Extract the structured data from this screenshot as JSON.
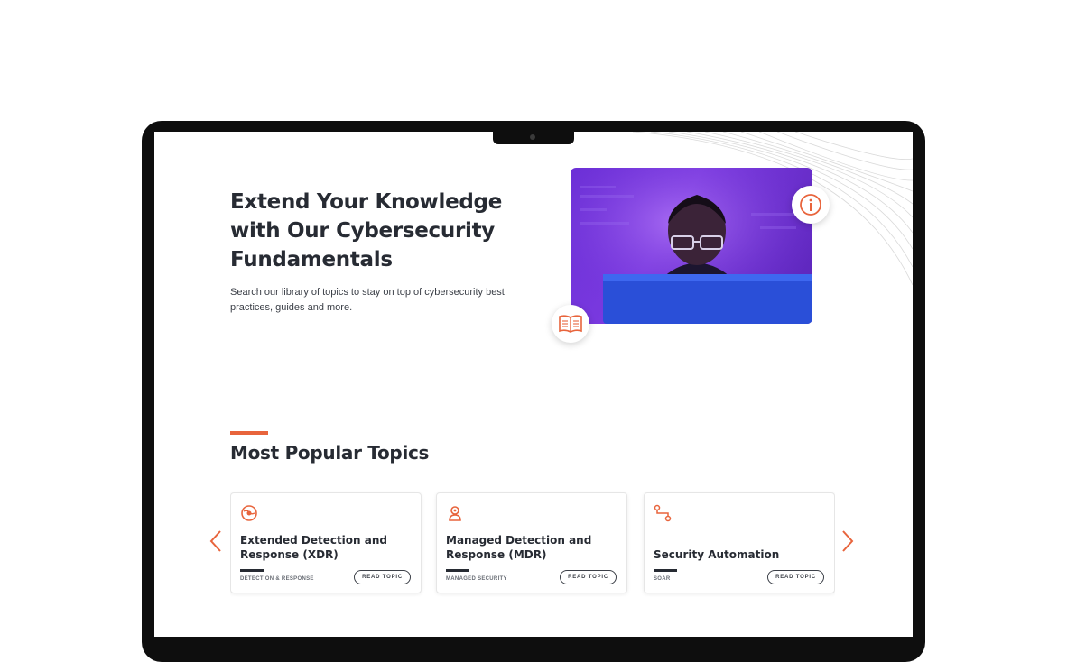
{
  "hero": {
    "title": "Extend Your Knowledge with Our Cybersecurity Fundamentals",
    "subtitle": "Search our library of topics to stay on top of cybersecurity best practices, guides and more."
  },
  "popular": {
    "title": "Most Popular Topics",
    "cards": [
      {
        "title": "Extended Detection and Response (XDR)",
        "tag": "DETECTION & RESPONSE",
        "button": "READ TOPIC",
        "icon": "globe-shield-icon"
      },
      {
        "title": "Managed Detection and Response (MDR)",
        "tag": "MANAGED SECURITY",
        "button": "READ TOPIC",
        "icon": "person-badge-icon"
      },
      {
        "title": "Security Automation",
        "tag": "SOAR",
        "button": "READ TOPIC",
        "icon": "workflow-icon"
      }
    ]
  },
  "colors": {
    "accent": "#e8643c",
    "text": "#272b33",
    "hero_bg": "#6b2fd6"
  }
}
